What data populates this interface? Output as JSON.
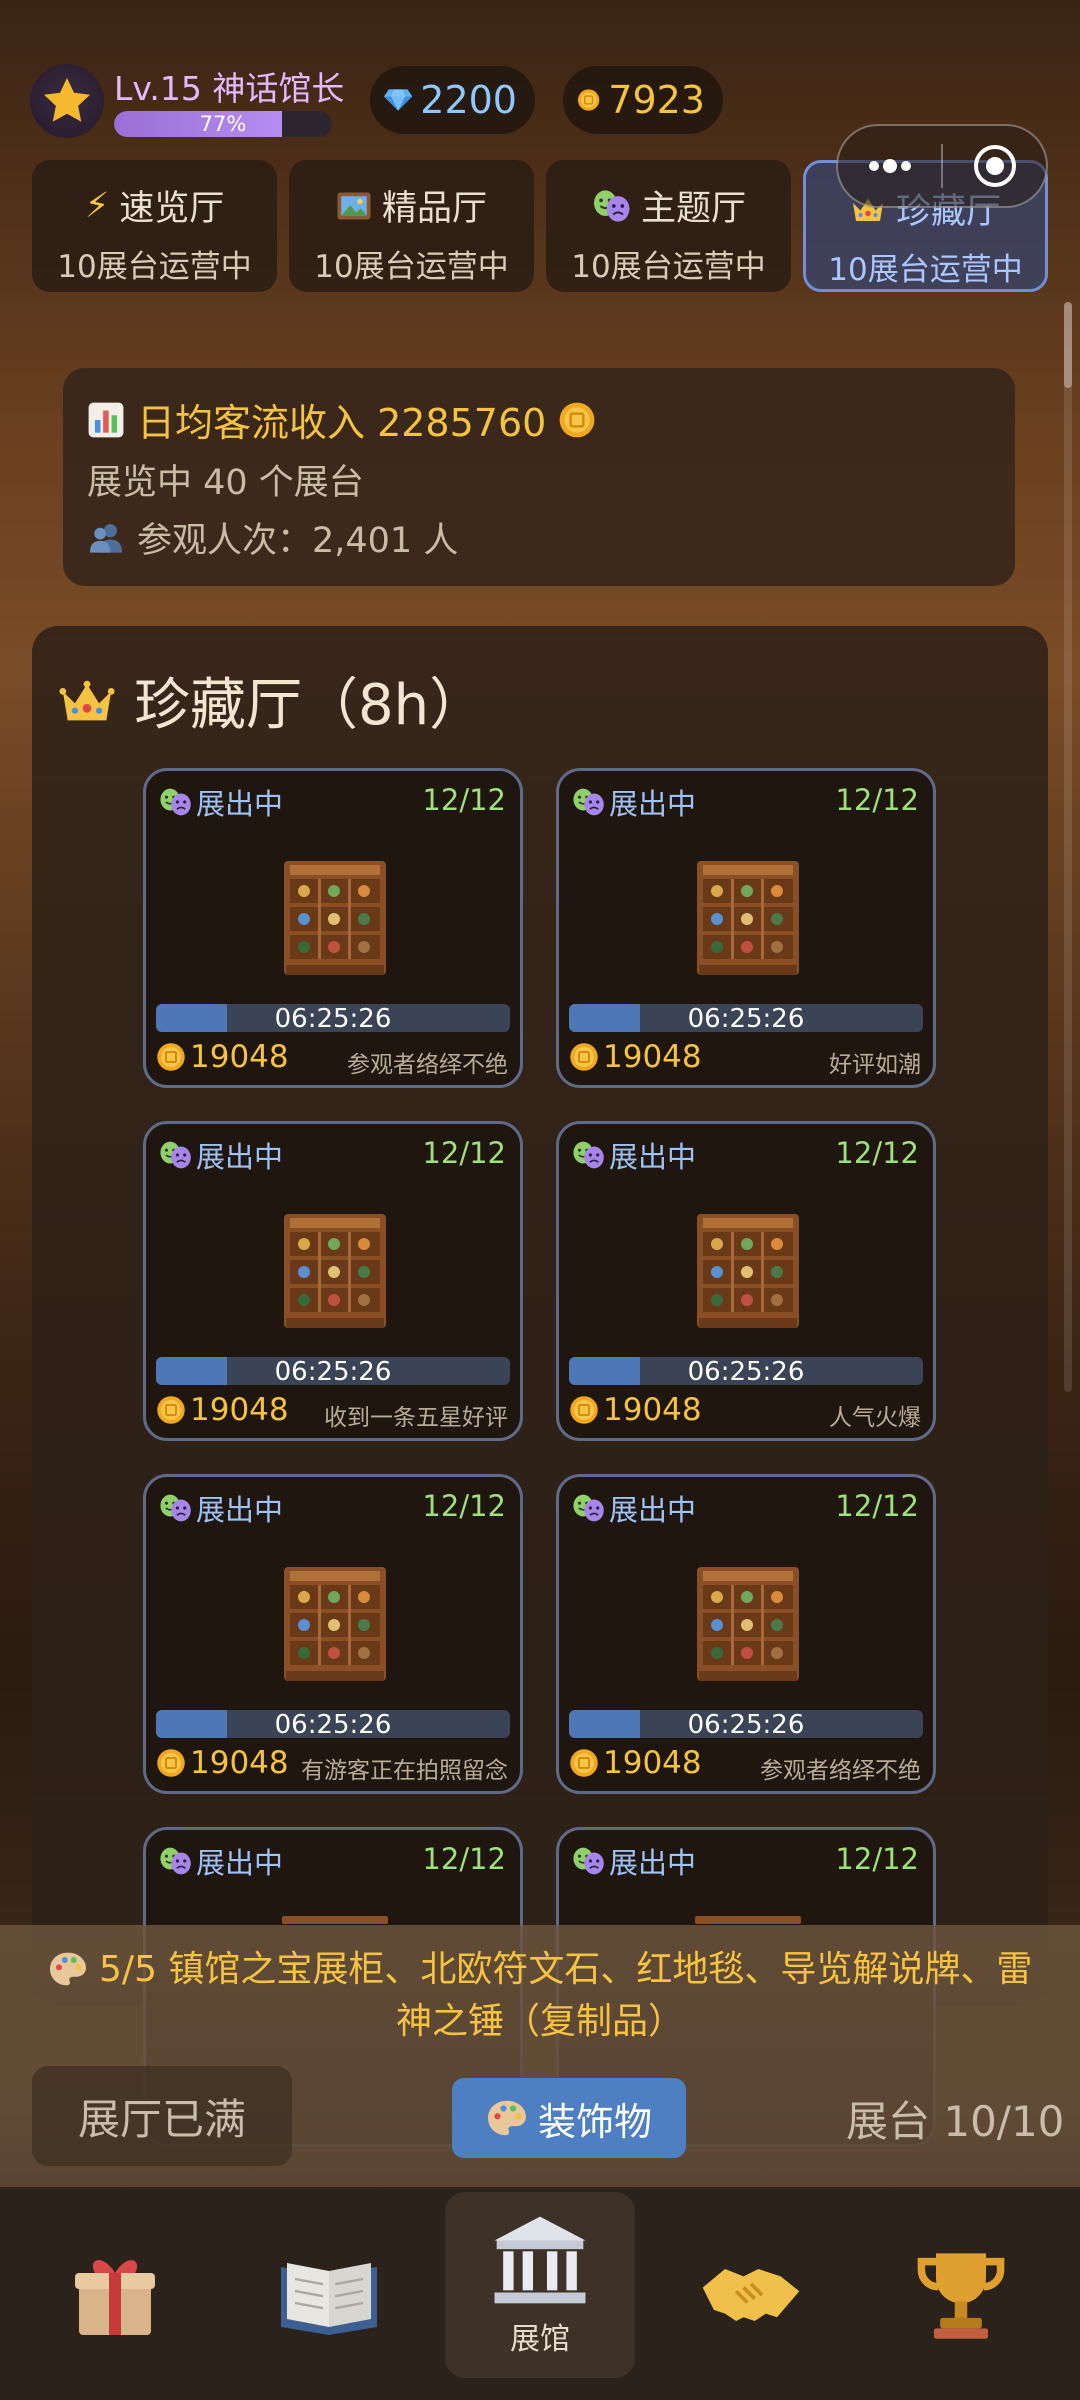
{
  "player": {
    "title": "Lv.15 神话馆长",
    "xp_percent_label": "77%",
    "xp_progress": 0.77
  },
  "currency": {
    "gems": "2200",
    "coins": "7923"
  },
  "hall_tabs": [
    {
      "icon": "lightning-icon",
      "name": "速览厅",
      "status": "10展台运营中"
    },
    {
      "icon": "framed-picture-icon",
      "name": "精品厅",
      "status": "10展台运营中"
    },
    {
      "icon": "theater-masks-icon",
      "name": "主题厅",
      "status": "10展台运营中"
    },
    {
      "icon": "crown-icon",
      "name": "珍藏厅",
      "status": "10展台运营中",
      "active": true
    }
  ],
  "stats": {
    "income": "日均客流收入 2285760",
    "exhibits": "展览中 40 个展台",
    "visitors": "参观人次：2,401 人"
  },
  "hall": {
    "title": "珍藏厅（8h）"
  },
  "cards": [
    {
      "status": "展出中",
      "capacity": "12/12",
      "timer": "06:25:26",
      "progress": 0.2,
      "coins": "19048",
      "message": "参观者络绎不绝"
    },
    {
      "status": "展出中",
      "capacity": "12/12",
      "timer": "06:25:26",
      "progress": 0.2,
      "coins": "19048",
      "message": "好评如潮"
    },
    {
      "status": "展出中",
      "capacity": "12/12",
      "timer": "06:25:26",
      "progress": 0.2,
      "coins": "19048",
      "message": "收到一条五星好评"
    },
    {
      "status": "展出中",
      "capacity": "12/12",
      "timer": "06:25:26",
      "progress": 0.2,
      "coins": "19048",
      "message": "人气火爆"
    },
    {
      "status": "展出中",
      "capacity": "12/12",
      "timer": "06:25:26",
      "progress": 0.2,
      "coins": "19048",
      "message": "有游客正在拍照留念"
    },
    {
      "status": "展出中",
      "capacity": "12/12",
      "timer": "06:25:26",
      "progress": 0.2,
      "coins": "19048",
      "message": "参观者络绎不绝"
    },
    {
      "status": "展出中",
      "capacity": "12/12"
    },
    {
      "status": "展出中",
      "capacity": "12/12"
    }
  ],
  "decorations": {
    "text": "5/5 镇馆之宝展柜、北欧符文石、红地毯、导览解说牌、雷神之锤（复制品）"
  },
  "actions": {
    "hall_full": "展厅已满",
    "decorations": "装饰物",
    "booths": "展台 10/10"
  },
  "nav": {
    "active_label": "展馆"
  }
}
